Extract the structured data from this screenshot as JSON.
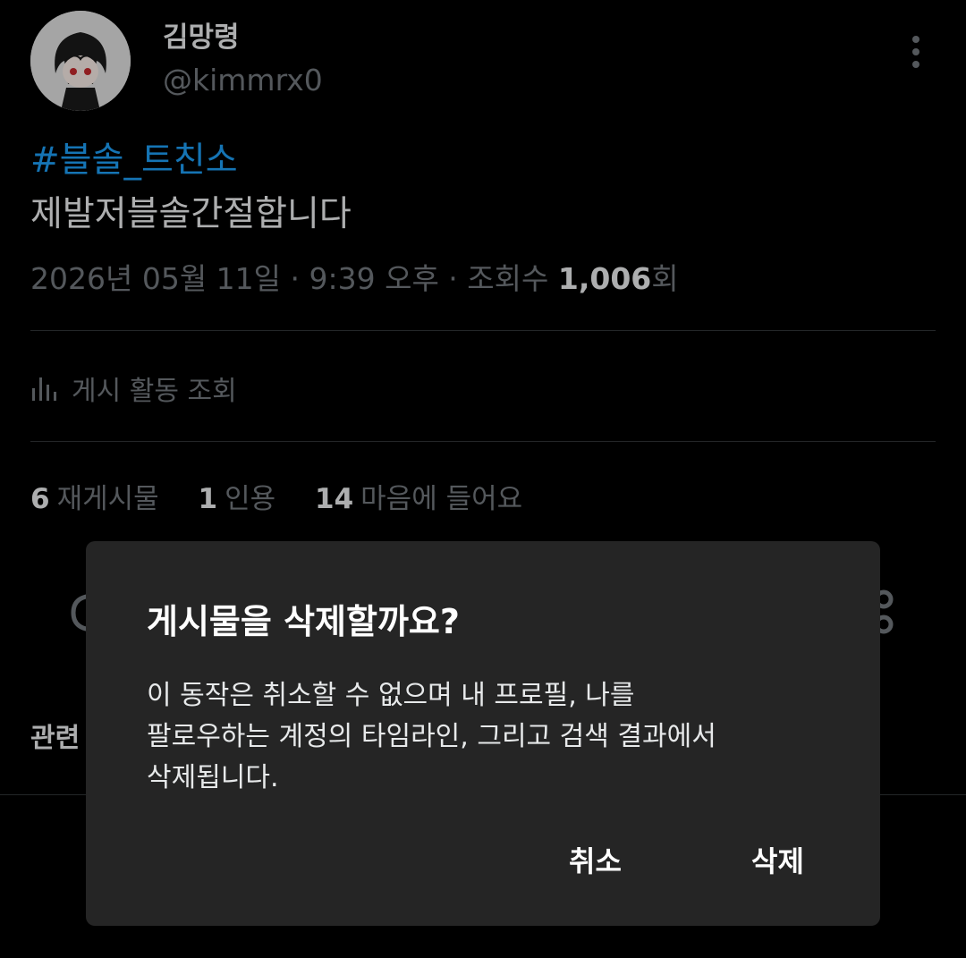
{
  "author": {
    "display_name": "김망령",
    "handle": "@kimmrx0",
    "avatar_icon": "avatar-character"
  },
  "post": {
    "hashtag": "#블솔_트친소",
    "text": "제발저블솔간절합니다",
    "date": "2026년 05월 11일 · 9:39 오후 · 조회수 ",
    "views": "1,006",
    "views_suffix": "회"
  },
  "activity": {
    "icon": "bar-chart-icon",
    "label": "게시 활동 조회"
  },
  "stats": {
    "reposts_count": "6",
    "reposts_label": "재게시물",
    "quotes_count": "1",
    "quotes_label": "인용",
    "likes_count": "14",
    "likes_label": "마음에 들어요"
  },
  "related": {
    "label": "관련"
  },
  "dialog": {
    "title": "게시물을 삭제할까요?",
    "message_lines": [
      "이 동작은 취소할 수 없으며 내 프로필, 나를",
      "팔로우하는 계정의 타임라인, 그리고 검색 결과에서",
      "삭제됩니다."
    ],
    "cancel_label": "취소",
    "delete_label": "삭제"
  },
  "colors": {
    "background": "#000000",
    "hashtag": "#1d9bf0",
    "muted": "#71767b",
    "dialog_bg": "#252525"
  }
}
